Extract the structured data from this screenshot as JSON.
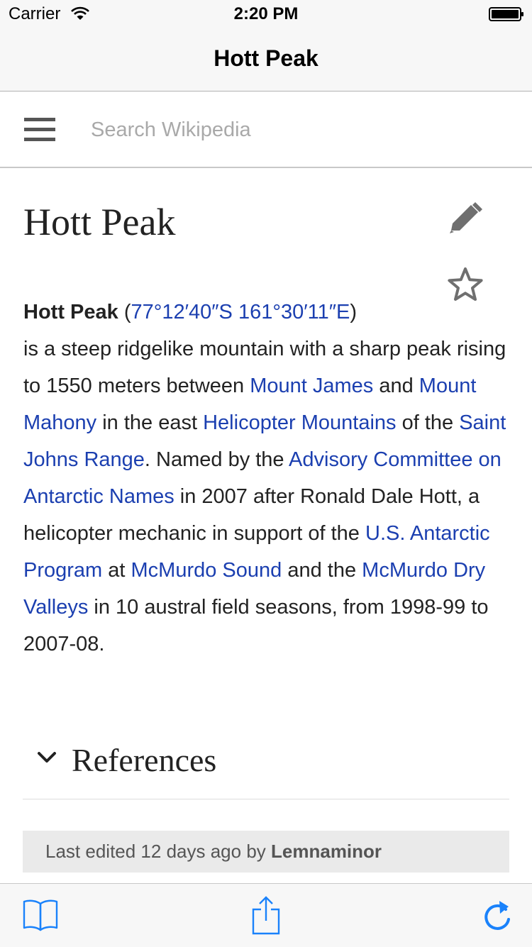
{
  "status_bar": {
    "carrier": "Carrier",
    "time": "2:20 PM",
    "wifi_icon": "wifi-icon",
    "battery_icon": "battery-icon"
  },
  "nav": {
    "title": "Hott Peak"
  },
  "search": {
    "placeholder": "Search Wikipedia",
    "value": "",
    "menu_icon": "hamburger-menu-icon"
  },
  "article": {
    "title": "Hott Peak",
    "edit_icon": "pencil-icon",
    "save_icon": "star-icon",
    "body": {
      "bold_title": "Hott Peak",
      "open_paren": " (",
      "coords_link": "77°12′40″S 161°30′11″E",
      "close_paren": ")",
      "t1": " is a steep ridgelike mountain with a sharp peak rising to 1550 meters between ",
      "link_mount_james": "Mount James",
      "t2": " and ",
      "link_mount_mahony": "Mount Mahony",
      "t3": " in the east ",
      "link_helicopter": "Helicopter Mountains",
      "t4": " of the ",
      "link_saint_johns": "Saint Johns Range",
      "t5": ". Named by the ",
      "link_acan": "Advisory Committee on Antarctic Names",
      "t6": " in 2007 after Ronald Dale Hott, a helicopter mechanic in support of the ",
      "link_usap": "U.S. Antarctic Program",
      "t7": " at ",
      "link_mcmurdo_sound": "McMurdo Sound",
      "t8": " and the ",
      "link_dry_valleys": "McMurdo Dry Valleys",
      "t9": " in 10 austral field seasons, from 1998-99 to 2007-08."
    },
    "references": {
      "label": "References",
      "chevron_icon": "chevron-down-icon"
    },
    "last_edited": {
      "prefix": "Last edited 12 days ago by ",
      "user": "Lemnaminor"
    }
  },
  "toolbar": {
    "toc_icon": "book-icon",
    "share_icon": "share-icon",
    "reload_icon": "refresh-icon"
  },
  "colors": {
    "link": "#1b3fb0",
    "ios_blue": "#1a82fb",
    "bar_bg": "#f7f7f7",
    "icon_gray": "#777777"
  }
}
